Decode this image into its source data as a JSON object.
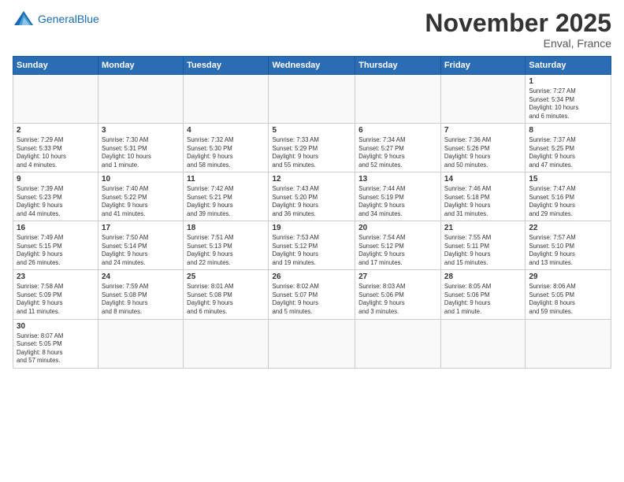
{
  "header": {
    "logo_general": "General",
    "logo_blue": "Blue",
    "month_title": "November 2025",
    "subtitle": "Enval, France"
  },
  "weekdays": [
    "Sunday",
    "Monday",
    "Tuesday",
    "Wednesday",
    "Thursday",
    "Friday",
    "Saturday"
  ],
  "weeks": [
    [
      {
        "day": "",
        "info": ""
      },
      {
        "day": "",
        "info": ""
      },
      {
        "day": "",
        "info": ""
      },
      {
        "day": "",
        "info": ""
      },
      {
        "day": "",
        "info": ""
      },
      {
        "day": "",
        "info": ""
      },
      {
        "day": "1",
        "info": "Sunrise: 7:27 AM\nSunset: 5:34 PM\nDaylight: 10 hours\nand 6 minutes."
      }
    ],
    [
      {
        "day": "2",
        "info": "Sunrise: 7:29 AM\nSunset: 5:33 PM\nDaylight: 10 hours\nand 4 minutes."
      },
      {
        "day": "3",
        "info": "Sunrise: 7:30 AM\nSunset: 5:31 PM\nDaylight: 10 hours\nand 1 minute."
      },
      {
        "day": "4",
        "info": "Sunrise: 7:32 AM\nSunset: 5:30 PM\nDaylight: 9 hours\nand 58 minutes."
      },
      {
        "day": "5",
        "info": "Sunrise: 7:33 AM\nSunset: 5:29 PM\nDaylight: 9 hours\nand 55 minutes."
      },
      {
        "day": "6",
        "info": "Sunrise: 7:34 AM\nSunset: 5:27 PM\nDaylight: 9 hours\nand 52 minutes."
      },
      {
        "day": "7",
        "info": "Sunrise: 7:36 AM\nSunset: 5:26 PM\nDaylight: 9 hours\nand 50 minutes."
      },
      {
        "day": "8",
        "info": "Sunrise: 7:37 AM\nSunset: 5:25 PM\nDaylight: 9 hours\nand 47 minutes."
      }
    ],
    [
      {
        "day": "9",
        "info": "Sunrise: 7:39 AM\nSunset: 5:23 PM\nDaylight: 9 hours\nand 44 minutes."
      },
      {
        "day": "10",
        "info": "Sunrise: 7:40 AM\nSunset: 5:22 PM\nDaylight: 9 hours\nand 41 minutes."
      },
      {
        "day": "11",
        "info": "Sunrise: 7:42 AM\nSunset: 5:21 PM\nDaylight: 9 hours\nand 39 minutes."
      },
      {
        "day": "12",
        "info": "Sunrise: 7:43 AM\nSunset: 5:20 PM\nDaylight: 9 hours\nand 36 minutes."
      },
      {
        "day": "13",
        "info": "Sunrise: 7:44 AM\nSunset: 5:19 PM\nDaylight: 9 hours\nand 34 minutes."
      },
      {
        "day": "14",
        "info": "Sunrise: 7:46 AM\nSunset: 5:18 PM\nDaylight: 9 hours\nand 31 minutes."
      },
      {
        "day": "15",
        "info": "Sunrise: 7:47 AM\nSunset: 5:16 PM\nDaylight: 9 hours\nand 29 minutes."
      }
    ],
    [
      {
        "day": "16",
        "info": "Sunrise: 7:49 AM\nSunset: 5:15 PM\nDaylight: 9 hours\nand 26 minutes."
      },
      {
        "day": "17",
        "info": "Sunrise: 7:50 AM\nSunset: 5:14 PM\nDaylight: 9 hours\nand 24 minutes."
      },
      {
        "day": "18",
        "info": "Sunrise: 7:51 AM\nSunset: 5:13 PM\nDaylight: 9 hours\nand 22 minutes."
      },
      {
        "day": "19",
        "info": "Sunrise: 7:53 AM\nSunset: 5:12 PM\nDaylight: 9 hours\nand 19 minutes."
      },
      {
        "day": "20",
        "info": "Sunrise: 7:54 AM\nSunset: 5:12 PM\nDaylight: 9 hours\nand 17 minutes."
      },
      {
        "day": "21",
        "info": "Sunrise: 7:55 AM\nSunset: 5:11 PM\nDaylight: 9 hours\nand 15 minutes."
      },
      {
        "day": "22",
        "info": "Sunrise: 7:57 AM\nSunset: 5:10 PM\nDaylight: 9 hours\nand 13 minutes."
      }
    ],
    [
      {
        "day": "23",
        "info": "Sunrise: 7:58 AM\nSunset: 5:09 PM\nDaylight: 9 hours\nand 11 minutes."
      },
      {
        "day": "24",
        "info": "Sunrise: 7:59 AM\nSunset: 5:08 PM\nDaylight: 9 hours\nand 8 minutes."
      },
      {
        "day": "25",
        "info": "Sunrise: 8:01 AM\nSunset: 5:08 PM\nDaylight: 9 hours\nand 6 minutes."
      },
      {
        "day": "26",
        "info": "Sunrise: 8:02 AM\nSunset: 5:07 PM\nDaylight: 9 hours\nand 5 minutes."
      },
      {
        "day": "27",
        "info": "Sunrise: 8:03 AM\nSunset: 5:06 PM\nDaylight: 9 hours\nand 3 minutes."
      },
      {
        "day": "28",
        "info": "Sunrise: 8:05 AM\nSunset: 5:06 PM\nDaylight: 9 hours\nand 1 minute."
      },
      {
        "day": "29",
        "info": "Sunrise: 8:06 AM\nSunset: 5:05 PM\nDaylight: 8 hours\nand 59 minutes."
      }
    ],
    [
      {
        "day": "30",
        "info": "Sunrise: 8:07 AM\nSunset: 5:05 PM\nDaylight: 8 hours\nand 57 minutes."
      },
      {
        "day": "",
        "info": ""
      },
      {
        "day": "",
        "info": ""
      },
      {
        "day": "",
        "info": ""
      },
      {
        "day": "",
        "info": ""
      },
      {
        "day": "",
        "info": ""
      },
      {
        "day": "",
        "info": ""
      }
    ]
  ]
}
